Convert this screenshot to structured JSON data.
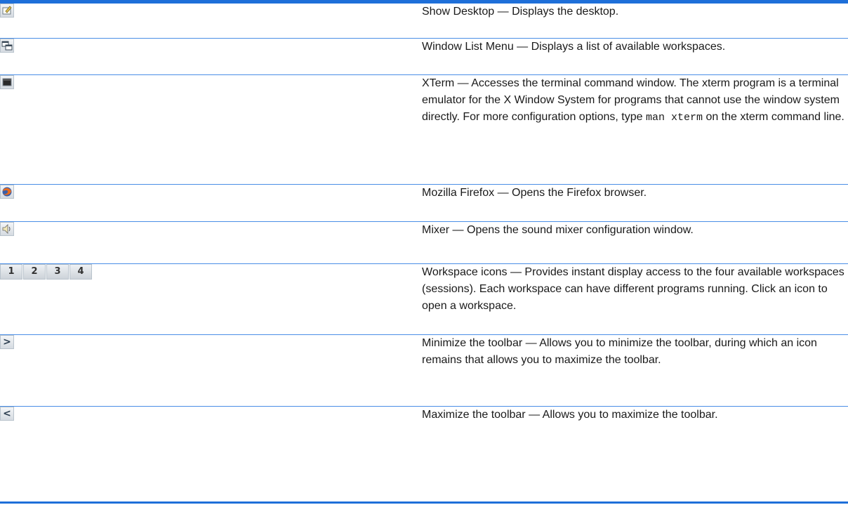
{
  "rows": [
    {
      "icon": "show-desktop-icon",
      "title": "Show Desktop",
      "desc": "Displays the desktop."
    },
    {
      "icon": "window-list-icon",
      "title": "Window List Menu",
      "desc": "Displays a list of available workspaces."
    },
    {
      "icon": "xterm-icon",
      "title": "XTerm",
      "desc_before": "Accesses the terminal command window. The xterm program is a terminal emulator for the X Window System for programs that cannot use the window system directly. For more configuration options, type",
      "code": "man xterm",
      "desc_after": "on the xterm command line."
    },
    {
      "icon": "firefox-icon",
      "title": "Mozilla Firefox",
      "desc": "Opens the Firefox browser."
    },
    {
      "icon": "mixer-speaker-icon",
      "title": "Mixer",
      "desc": "Opens the sound mixer configuration window."
    },
    {
      "icon": "workspace-icons",
      "title": "Workspace icons",
      "desc": "Provides instant display access to the four available workspaces (sessions). Each workspace can have different programs running. Click an icon to open a workspace.",
      "workspaces": [
        "1",
        "2",
        "3",
        "4"
      ]
    },
    {
      "icon": "minimize-toolbar-icon",
      "title": "Minimize the toolbar",
      "desc": "Allows you to minimize the toolbar, during which an icon remains that allows you to maximize the toolbar.",
      "glyph": ">"
    },
    {
      "icon": "maximize-toolbar-icon",
      "title": "Maximize the toolbar",
      "desc": "Allows you to maximize the toolbar.",
      "glyph": "<"
    }
  ],
  "dash": " — ",
  "colors": {
    "rule": "#1e6fd9",
    "divider": "#4a8ee6"
  }
}
